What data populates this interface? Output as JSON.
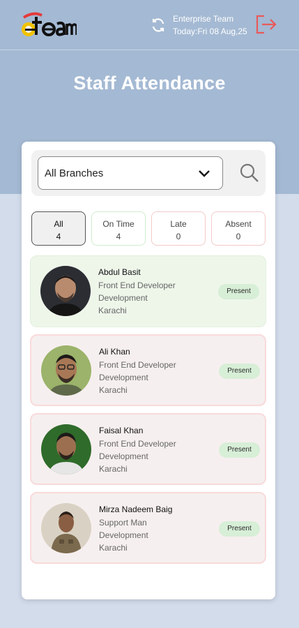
{
  "header": {
    "logo_text": "eteam",
    "team_name": "Enterprise Team",
    "today": "Today:Fri 08 Aug,25"
  },
  "page": {
    "title": "Staff Attendance"
  },
  "filter": {
    "branch": "All Branches"
  },
  "tabs": [
    {
      "label": "All",
      "count": "4"
    },
    {
      "label": "On Time",
      "count": "4"
    },
    {
      "label": "Late",
      "count": "0"
    },
    {
      "label": "Absent",
      "count": "0"
    }
  ],
  "staff": [
    {
      "name": "Abdul Basit",
      "role": "Front End Developer",
      "department": "Development",
      "city": "Karachi",
      "status": "Present"
    },
    {
      "name": "Ali Khan",
      "role": "Front End Developer",
      "department": "Development",
      "city": "Karachi",
      "status": "Present"
    },
    {
      "name": "Faisal Khan",
      "role": "Front End Developer",
      "department": "Development",
      "city": "Karachi",
      "status": "Present"
    },
    {
      "name": "Mirza Nadeem Baig",
      "role": "Support Man",
      "department": "Development",
      "city": "Karachi",
      "status": "Present"
    }
  ],
  "icons": [
    "sync-icon",
    "logout-icon",
    "chevron-down-icon",
    "search-icon"
  ],
  "colors": {
    "header_bg": "#a4b9d3",
    "page_bg": "#d3dceb",
    "present_badge": "#d7eed7",
    "logout": "#e85a5a"
  }
}
